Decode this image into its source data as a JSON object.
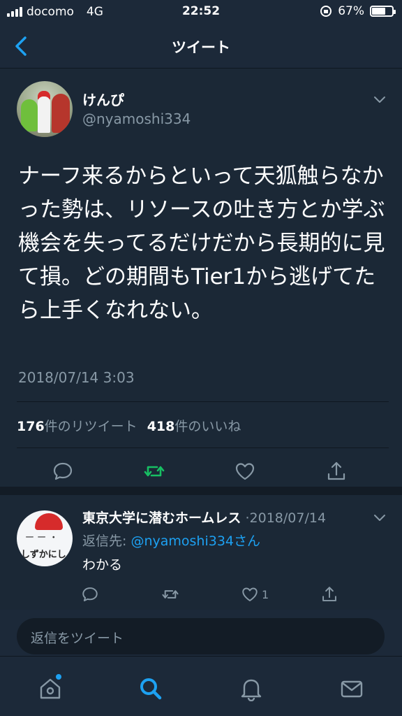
{
  "status_bar": {
    "carrier": "docomo",
    "network": "4G",
    "time": "22:52",
    "battery": "67%",
    "battery_level": 0.67
  },
  "nav": {
    "title": "ツイート"
  },
  "tweet": {
    "author_name": "けんぴ",
    "author_handle": "@nyamoshi334",
    "text": "ナーフ来るからといって天狐触らなかった勢は、リソースの吐き方とか学ぶ機会を失ってるだけだから長期的に見て損。どの期間もTier1から逃げてたら上手くなれない。",
    "timestamp": "2018/07/14 3:03",
    "retweet_count": "176",
    "retweet_label": "件のリツイート",
    "like_count": "418",
    "like_label": "件のいいね"
  },
  "reply": {
    "author_name": "東京大学に潜むホームレス",
    "separator": "·",
    "date": "2018/07/14",
    "reply_to_prefix": "返信先:",
    "reply_to_mention": "@nyamoshi334さん",
    "text": "わかる",
    "avatar_text": "しずかにし",
    "like_count": "1"
  },
  "compose": {
    "placeholder": "返信をツイート"
  },
  "colors": {
    "background": "#1b2836",
    "accent": "#1da1f2",
    "retweet_green": "#17bf63",
    "secondary_text": "#8899a6"
  }
}
